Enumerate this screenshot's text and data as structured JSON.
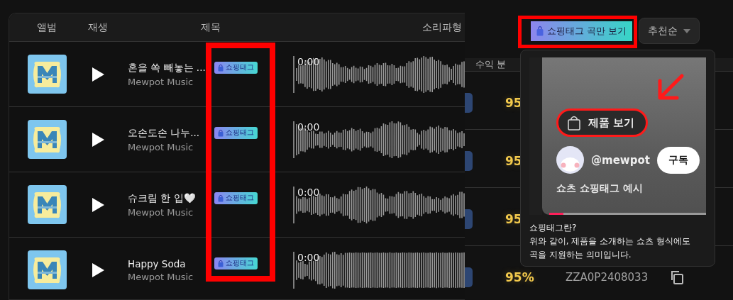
{
  "table": {
    "columns": [
      "앨범",
      "재생",
      "제목",
      "소리파형"
    ],
    "rows": [
      {
        "title": "혼을 쏙 빼놓는 ...",
        "artist": "Mewpot Music",
        "tag": "쇼핑태그",
        "time": "0:00"
      },
      {
        "title": "오손도손 나누...",
        "artist": "Mewpot Music",
        "tag": "쇼핑태그",
        "time": "0:00"
      },
      {
        "title": "슈크림 한 입🤍",
        "artist": "Mewpot Music",
        "tag": "쇼핑태그",
        "time": "0:00"
      },
      {
        "title": "Happy Soda",
        "artist": "Mewpot Music",
        "tag": "쇼핑태그",
        "time": "0:00"
      }
    ]
  },
  "toolbar": {
    "filter_button": "쇼핑태그 곡만 보기",
    "sort": "추천순"
  },
  "side_table": {
    "column": "수익 분",
    "rows": [
      {
        "share": "95"
      },
      {
        "share": "95"
      },
      {
        "share": "95"
      },
      {
        "share": "95%",
        "code": "ZZA0P2408033"
      }
    ]
  },
  "popover": {
    "preview": {
      "product_button": "제품 보기",
      "channel": "@mewpot",
      "subscribe": "구독",
      "caption": "쇼츠 쇼핑태그 예시",
      "level": 0.09
    },
    "heading": "쇼핑태그란?",
    "lines": [
      "위와 같이, 제품을 소개하는 쇼츠 형식에도",
      "곡을 지원하는 의미입니다."
    ]
  }
}
